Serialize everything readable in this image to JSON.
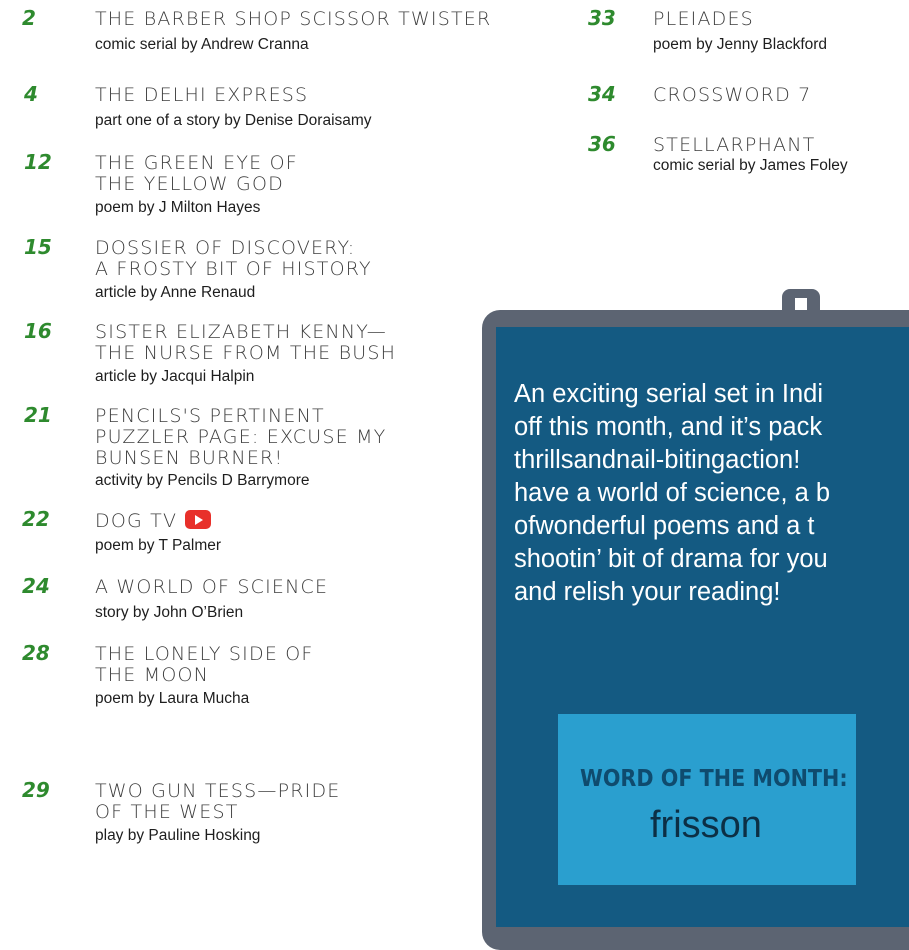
{
  "toc_left": [
    {
      "num": "2",
      "title": "THE BARBER SHOP SCISSOR TWISTER",
      "sub": "comic serial by Andrew Cranna"
    },
    {
      "num": "4",
      "title": "THE DELHI EXPRESS",
      "sub": "part one of a story by Denise Doraisamy"
    },
    {
      "num": "12",
      "title": "THE GREEN EYE OF\nTHE YELLOW GOD",
      "sub": "poem by J Milton Hayes"
    },
    {
      "num": "15",
      "title": "DOSSIER OF DISCOVERY:\nA FROSTY BIT OF HISTORY",
      "sub": "article by Anne Renaud"
    },
    {
      "num": "16",
      "title": "SISTER ELIZABETH KENNY—\nTHE NURSE FROM THE BUSH",
      "sub": "article by Jacqui Halpin"
    },
    {
      "num": "21",
      "title": "PENCILS'S PERTINENT\nPUZZLER PAGE: EXCUSE MY\nBUNSEN BURNER!",
      "sub": "activity by Pencils D Barrymore"
    },
    {
      "num": "22",
      "title": "DOG TV",
      "sub": "poem by T Palmer"
    },
    {
      "num": "24",
      "title": "A WORLD OF SCIENCE",
      "sub": "story by John O’Brien"
    },
    {
      "num": "28",
      "title": "THE LONELY SIDE OF\nTHE MOON",
      "sub": "poem by Laura Mucha"
    },
    {
      "num": "29",
      "title": "TWO GUN TESS—PRIDE\nOF THE WEST",
      "sub": "play by Pauline Hosking"
    }
  ],
  "toc_right": [
    {
      "num": "33",
      "title": "PLEIADES",
      "sub": "poem by Jenny Blackford"
    },
    {
      "num": "34",
      "title": "CROSSWORD 7",
      "sub": ""
    },
    {
      "num": "36",
      "title": "STELLARPHANT",
      "sub": "comic serial by James Foley"
    }
  ],
  "blurb": "An exciting serial set in Indi\noff this month, and it’s pack\nthrillsandnail-bitingaction!\nhave a world of science, a b\nofwonderful poems and a t\nshootin’ bit of drama for you\nand relish your reading!",
  "word_of_month": {
    "label": "WORD OF THE MONTH:",
    "word": "frisson"
  },
  "icons": {
    "video": "youtube-play-icon"
  },
  "colors": {
    "page_number": "#2e8a2e",
    "screen": "#145a82",
    "word_box": "#2a9fcf"
  }
}
